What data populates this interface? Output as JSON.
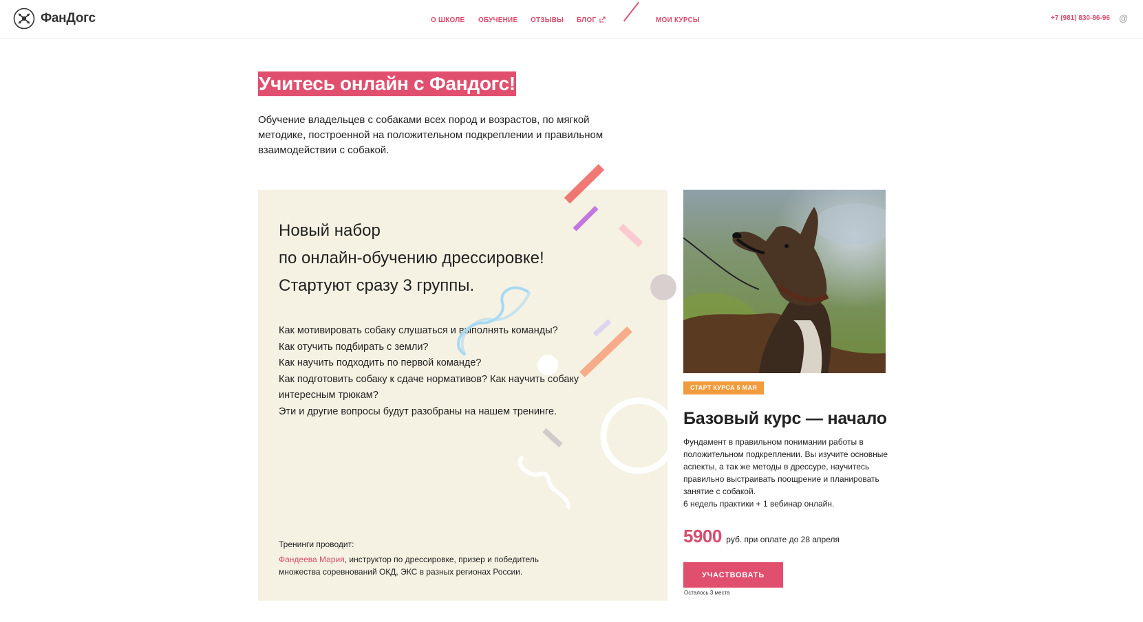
{
  "header": {
    "logo_text": "ФанДогс",
    "nav": [
      {
        "label": "О школе"
      },
      {
        "label": "Обучение"
      },
      {
        "label": "Отзывы"
      },
      {
        "label": "Блог"
      },
      {
        "label": "Мои курсы"
      }
    ],
    "phone": "+7 (981) 830-86-96",
    "at_symbol": "@"
  },
  "hero": {
    "title": "Учитесь онлайн с Фандогс!",
    "description": "Обучение владельцев с собаками всех пород и возрастов, по мягкой методике, построенной на положительном подкреплении и правильном взаимодействии с собакой."
  },
  "promo": {
    "heading_lines": [
      "Новый набор",
      "по онлайн-обучению дрессировке!",
      "Стартуют сразу 3 группы."
    ],
    "questions": [
      "Как мотивировать собаку слушаться и выполнять команды?",
      "Как отучить подбирать с земли?",
      "Как научить подходить по первой команде?",
      "Как подготовить собаку к сдаче нормативов? Как научить собаку интересным трюкам?",
      "Эти и другие вопросы будут разобраны на нашем тренинге."
    ],
    "trainer_label": "Тренинги проводит:",
    "trainer_name": "Фандеева Мария",
    "trainer_bio": ", инструктор по дрессировке, призер и победитель множества соревнований ОКД, ЭКС в разных регионах России."
  },
  "course": {
    "badge": "Старт курса 5 мая",
    "title": "Базовый курс — начало",
    "description": "Фундамент в правильном понимании работы в положительном подкреплении. Вы изучите основные аспекты, а так же методы в дрессуре, научитесь правильно выстраивать поощрение и планировать занятие с собакой.",
    "schedule": "6 недель практики + 1 вебинар онлайн.",
    "price": "5900",
    "price_note": "руб. при оплате до 28 апреля",
    "button_label": "Участвовать",
    "seats_left": "Осталось 3 места"
  },
  "colors": {
    "accent": "#e04f6e",
    "badge": "#f19b3c",
    "panel_bg": "#f5f2e3"
  }
}
